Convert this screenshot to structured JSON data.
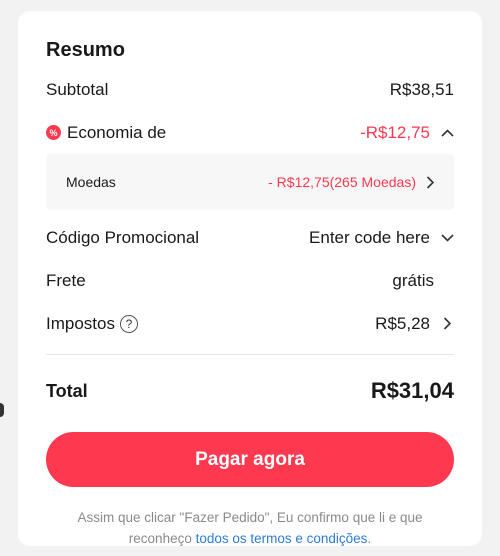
{
  "summary": {
    "title": "Resumo",
    "subtotal": {
      "label": "Subtotal",
      "value": "R$38,51"
    },
    "savings": {
      "label": "Economia de",
      "value": "-R$12,75",
      "icon": "discount-icon",
      "expanded": true
    },
    "coins": {
      "label": "Moedas",
      "value": "- R$12,75(265 Moedas)"
    },
    "promo": {
      "label": "Código Promocional",
      "value": "Enter code here"
    },
    "shipping": {
      "label": "Frete",
      "value": "grátis"
    },
    "taxes": {
      "label": "Impostos",
      "value": "R$5,28"
    },
    "total": {
      "label": "Total",
      "value": "R$31,04"
    }
  },
  "pay_button": {
    "label": "Pagar agora"
  },
  "disclaimer": {
    "text_before": "Assim que clicar \"Fazer Pedido\", Eu confirmo que li e que reconheço ",
    "link": "todos os termos e condições",
    "text_after": "."
  },
  "colors": {
    "accent": "#fd384f",
    "link": "#2e7bd6",
    "muted": "#8a8a8a"
  }
}
